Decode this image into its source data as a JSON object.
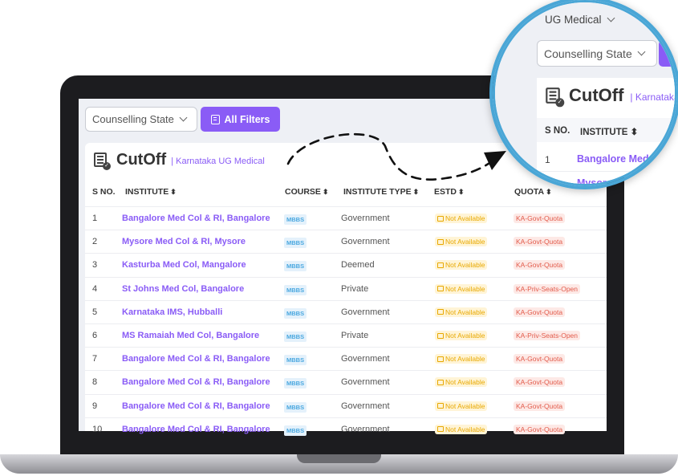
{
  "filters": {
    "state_select": "Counselling State",
    "all_filters_label": "All Filters"
  },
  "card": {
    "title": "CutOff",
    "subtitle": "| Karnataka UG Medical"
  },
  "table": {
    "headers": [
      "S NO.",
      "INSTITUTE",
      "COURSE",
      "INSTITUTE TYPE",
      "ESTD",
      "QUOTA"
    ],
    "rows": [
      {
        "sn": "1",
        "institute": "Bangalore Med Col & RI, Bangalore",
        "course": "MBBS",
        "type": "Government",
        "estd": "Not Available",
        "quota": "KA-Govt-Quota"
      },
      {
        "sn": "2",
        "institute": "Mysore Med Col & RI, Mysore",
        "course": "MBBS",
        "type": "Government",
        "estd": "Not Available",
        "quota": "KA-Govt-Quota"
      },
      {
        "sn": "3",
        "institute": "Kasturba Med Col, Mangalore",
        "course": "MBBS",
        "type": "Deemed",
        "estd": "Not Available",
        "quota": "KA-Govt-Quota"
      },
      {
        "sn": "4",
        "institute": "St Johns Med Col, Bangalore",
        "course": "MBBS",
        "type": "Private",
        "estd": "Not Available",
        "quota": "KA-Priv-Seats-Open"
      },
      {
        "sn": "5",
        "institute": "Karnataka IMS, Hubballi",
        "course": "MBBS",
        "type": "Government",
        "estd": "Not Available",
        "quota": "KA-Govt-Quota"
      },
      {
        "sn": "6",
        "institute": "MS Ramaiah Med Col, Bangalore",
        "course": "MBBS",
        "type": "Private",
        "estd": "Not Available",
        "quota": "KA-Priv-Seats-Open"
      },
      {
        "sn": "7",
        "institute": "Bangalore Med Col & RI, Bangalore",
        "course": "MBBS",
        "type": "Government",
        "estd": "Not Available",
        "quota": "KA-Govt-Quota"
      },
      {
        "sn": "8",
        "institute": "Bangalore Med Col & RI, Bangalore",
        "course": "MBBS",
        "type": "Government",
        "estd": "Not Available",
        "quota": "KA-Govt-Quota"
      },
      {
        "sn": "9",
        "institute": "Bangalore Med Col & RI, Bangalore",
        "course": "MBBS",
        "type": "Government",
        "estd": "Not Available",
        "quota": "KA-Govt-Quota"
      },
      {
        "sn": "10",
        "institute": "Bangalore Med Col & RI, Bangalore",
        "course": "MBBS",
        "type": "Government",
        "estd": "Not Available",
        "quota": "KA-Govt-Quota"
      }
    ]
  },
  "magnifier": {
    "category_select": "UG Medical",
    "state_select": "Counselling State",
    "title": "CutOff",
    "subtitle": "| Karnataka",
    "headers": [
      "S NO.",
      "INSTITUTE"
    ],
    "row1_sn": "1",
    "row1_institute": "Bangalore Med",
    "row2_institute": "Mysore"
  },
  "colors": {
    "accent": "#8a5cf6",
    "magnifier_ring": "#4aa6d6"
  }
}
